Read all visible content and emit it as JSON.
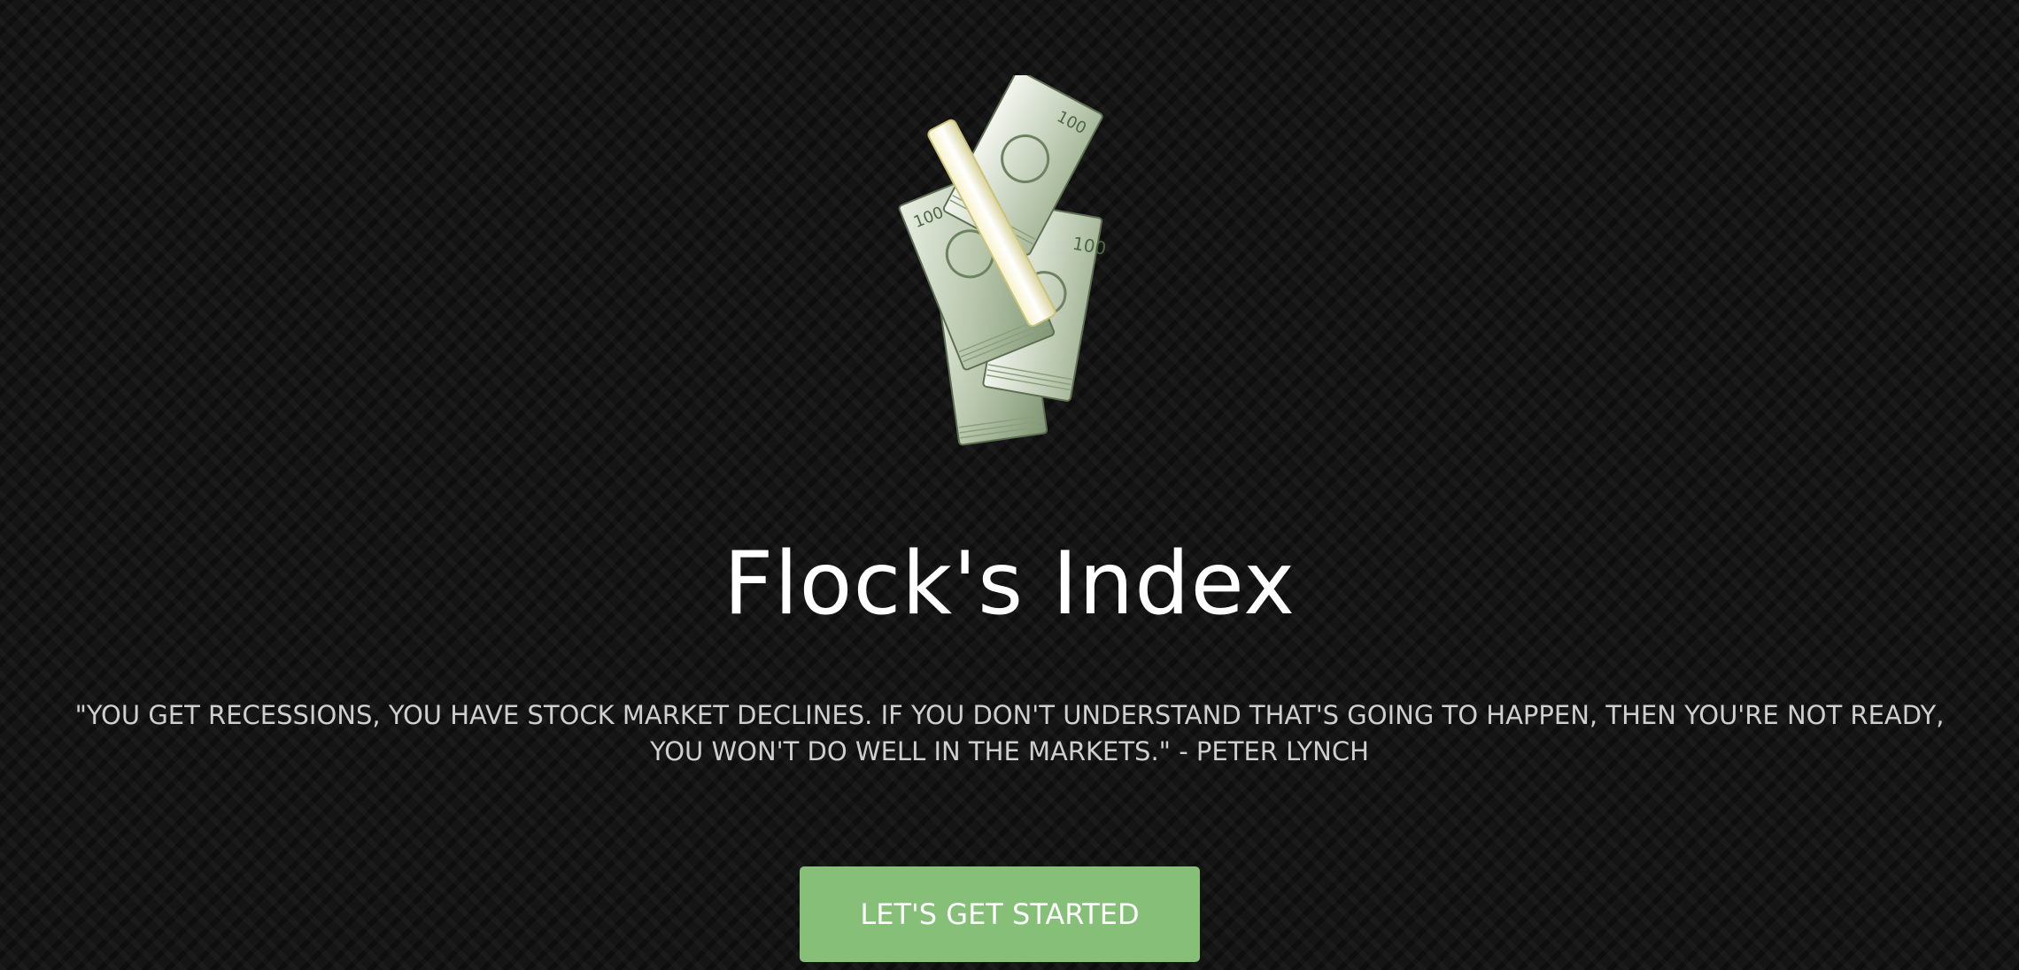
{
  "app": {
    "title": "Flock's Index"
  },
  "hero": {
    "image_icon": "money-stack-icon",
    "title": "Flock's Index",
    "quote": "\"YOU GET RECESSIONS, YOU HAVE STOCK MARKET DECLINES. IF YOU DON'T UNDERSTAND THAT'S GOING TO HAPPEN, THEN YOU'RE NOT READY, YOU WON'T DO WELL IN THE MARKETS.\" - PETER LYNCH",
    "cta_label": "LET'S GET STARTED"
  },
  "colors": {
    "background": "#151515",
    "title_text": "#ffffff",
    "quote_text": "#cfcfcf",
    "cta_background": "#86bf78",
    "cta_text": "#ffffff"
  }
}
